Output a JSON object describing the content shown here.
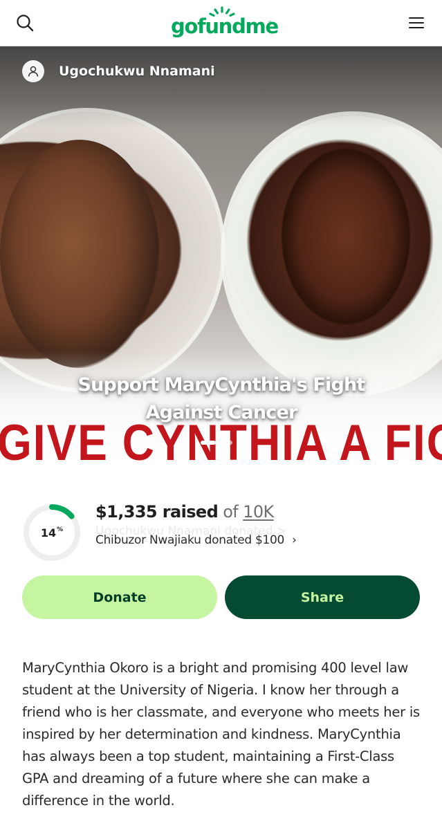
{
  "header": {
    "logo_text": "gofundme",
    "logo_tm": "™",
    "brand_color": "#02a95c",
    "search_icon": "search-icon",
    "menu_icon": "hamburger-menu-icon"
  },
  "hero": {
    "organizer_name": "Ugochukwu Nnamani",
    "title": "Support MaryCynthia's Fight Against Cancer",
    "banner_text": "GIVE CYNTHIA A FIGHTING CI",
    "carousel_dots": 3,
    "carousel_active_index": 0
  },
  "progress": {
    "percent_value": 0.14,
    "percent_label": "14",
    "percent_sign": "%",
    "raised_amount": "$1,335 raised",
    "of_label": "of",
    "goal": "10K",
    "ghost_text": "Ugochukwu Nnamani donated >",
    "recent_donation": "Chibuzor Nwajiaku donated $100",
    "chevron": "›",
    "ring_color": "#02a95c",
    "track_color": "#eeeeee"
  },
  "actions": {
    "donate_label": "Donate",
    "share_label": "Share",
    "donate_bg": "#c5f5a0",
    "share_bg": "#044b32"
  },
  "story": {
    "text": "MaryCynthia Okoro is a bright and promising 400 level law student at the University of Nigeria. I know her through a friend who is her classmate, and everyone who meets her is inspired by her determination and kindness. MaryCynthia has always been a top student, maintaining a First-Class GPA and dreaming of a future where she can make a difference in the world."
  }
}
